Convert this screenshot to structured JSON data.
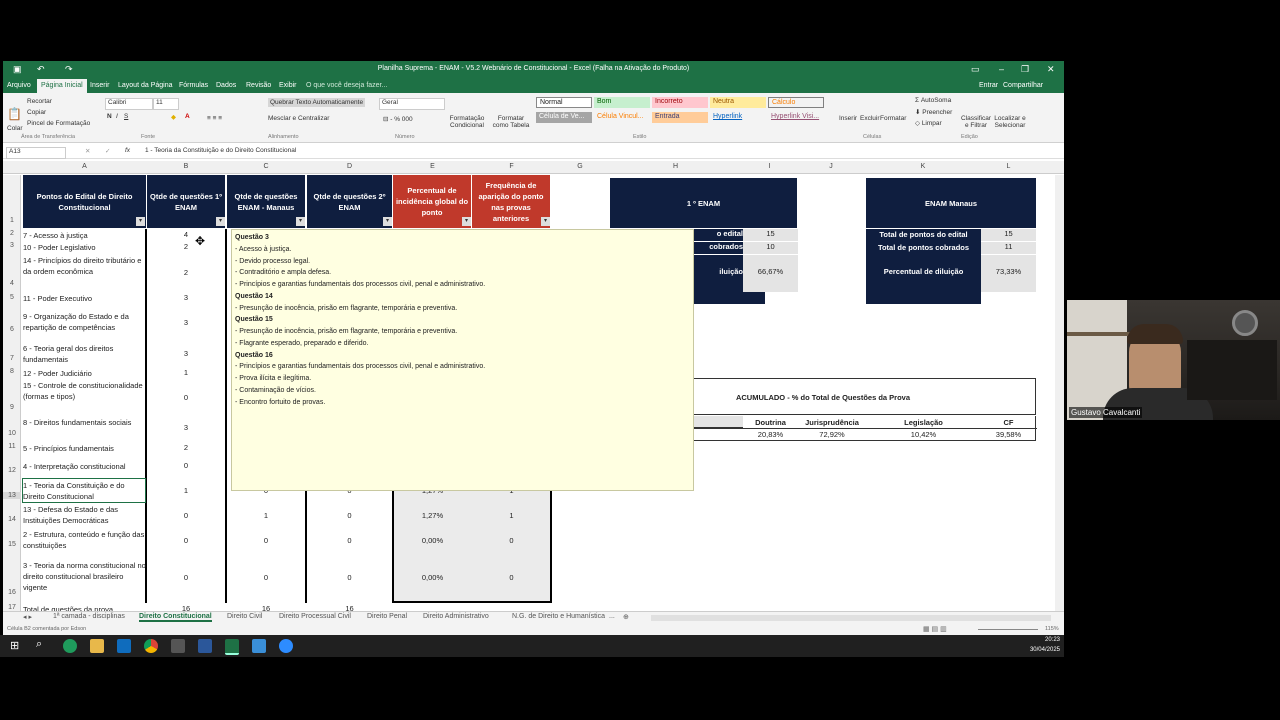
{
  "window": {
    "title": "Planilha Suprema - ENAM - V5.2 Webnário de Constitucional - Excel (Falha na Ativação do Produto)",
    "entrar": "Entrar",
    "compartilhar": "Compartilhar"
  },
  "menu": [
    "Arquivo",
    "Página Inicial",
    "Inserir",
    "Layout da Página",
    "Fórmulas",
    "Dados",
    "Revisão",
    "Exibir",
    "O que você deseja fazer..."
  ],
  "ribbon": {
    "recortar": "Recortar",
    "copiar": "Copiar",
    "pincel": "Pincel de Formatação",
    "colar": "Colar",
    "area_transferencia": "Área de Transferência",
    "fonte_nome": "Calibri",
    "fonte_tam": "11",
    "fonte": "Fonte",
    "quebrar": "Quebrar Texto Automaticamente",
    "mesclar": "Mesclar e Centralizar",
    "alinhamento": "Alinhamento",
    "geral": "Geral",
    "numero": "Número",
    "formatacao_cond": "Formatação Condicional",
    "formatar_tabela": "Formatar como Tabela",
    "estilo": "Estilo",
    "styles": {
      "normal": "Normal",
      "bom": "Bom",
      "incorreto": "Incorreto",
      "neutra": "Neutra",
      "calculo": "Cálculo",
      "celula_ve": "Célula de Ve...",
      "celula_vinc": "Célula Vincul...",
      "entrada": "Entrada",
      "hyperlink": "Hyperlink",
      "hyperlink_vis": "Hyperlink Visi..."
    },
    "inserir": "Inserir",
    "excluir": "Excluir",
    "formatar": "Formatar",
    "celulas": "Células",
    "autosoma": "AutoSoma",
    "preencher": "Preencher",
    "limpar": "Limpar",
    "classificar": "Classificar e Filtrar",
    "localizar": "Localizar e Selecionar",
    "edicao": "Edição"
  },
  "formula_bar": {
    "name_box": "A13",
    "fx": "fx",
    "value": "1 - Teoria da Constituição e do Direito Constitucional"
  },
  "columns": [
    "A",
    "B",
    "C",
    "D",
    "E",
    "F",
    "G",
    "H",
    "I",
    "J",
    "K",
    "L"
  ],
  "headers": {
    "a": "Pontos do Edital de Direito Constitucional",
    "b": "Qtde de questões 1º ENAM",
    "c": "Qtde de questões ENAM - Manaus",
    "d": "Qtde de questões 2º ENAM",
    "e": "Percentual de incidência global do ponto",
    "f": "Frequência de aparição do ponto nas provas anteriores"
  },
  "rows": [
    {
      "n": "2",
      "a": "7 - Acesso à justiça",
      "b": "4"
    },
    {
      "n": "3",
      "a": "10 - Poder Legislativo",
      "b": "2"
    },
    {
      "n": "4",
      "a": "14 - Princípios do direito tributário e da ordem econômica",
      "b": "2"
    },
    {
      "n": "5",
      "a": "11 - Poder Executivo",
      "b": "3"
    },
    {
      "n": "6",
      "a": "9 - Organização do Estado e da repartição de competências",
      "b": "3"
    },
    {
      "n": "7",
      "a": "6 - Teoria geral dos direitos fundamentais",
      "b": "3"
    },
    {
      "n": "8",
      "a": "12 - Poder Judiciário",
      "b": "1"
    },
    {
      "n": "9",
      "a": "15 - Controle de constitucionalidade (formas e tipos)",
      "b": "0"
    },
    {
      "n": "10",
      "a": "8 - Direitos fundamentais sociais",
      "b": "3"
    },
    {
      "n": "11",
      "a": "5 - Princípios fundamentais",
      "b": "2"
    },
    {
      "n": "12",
      "a": "4 - Interpretação constitucional",
      "b": "0"
    },
    {
      "n": "13",
      "a": "1 - Teoria da Constituição e do Direito Constitucional",
      "b": "1",
      "c": "0",
      "d": "0",
      "e": "1,27%",
      "f": "1"
    },
    {
      "n": "14",
      "a": "13 - Defesa do Estado e das Instituições Democráticas",
      "b": "0",
      "c": "1",
      "d": "0",
      "e": "1,27%",
      "f": "1"
    },
    {
      "n": "15",
      "a": "2 - Estrutura, conteúdo e função das constituições",
      "b": "0",
      "c": "0",
      "d": "0",
      "e": "0,00%",
      "f": "0"
    },
    {
      "n": "16",
      "a": "3 - Teoria da norma constitucional no direito constitucional brasileiro vigente",
      "b": "0",
      "c": "0",
      "d": "0",
      "e": "0,00%",
      "f": "0"
    },
    {
      "n": "17",
      "a": "Total de questões da prova",
      "b": "16",
      "c": "16",
      "d": "16"
    }
  ],
  "enam1": {
    "title": "1 º ENAM",
    "row1_label": "o edital",
    "row1_value": "15",
    "row2_label": "cobrados",
    "row2_value": "10",
    "row3_label": "iluição",
    "row3_value": "66,67%"
  },
  "manaus": {
    "title": "ENAM Manaus",
    "row1_label": "Total de pontos do edital",
    "row1_value": "15",
    "row2_label": "Total de pontos cobrados",
    "row2_value": "11",
    "row3_label": "Percentual de diluição",
    "row3_value": "73,33%"
  },
  "acumulado": {
    "title": "ACUMULADO - % do Total de Questões da Prova",
    "headers": [
      "Doutrina",
      "Jurisprudência",
      "Legislação",
      "CF"
    ],
    "values": [
      "20,83%",
      "72,92%",
      "10,42%",
      "39,58%"
    ]
  },
  "comment": [
    {
      "bold": true,
      "text": "Questão 3"
    },
    {
      "bold": false,
      "text": ""
    },
    {
      "bold": false,
      "text": "- Acesso à justiça."
    },
    {
      "bold": false,
      "text": "- Devido processo legal."
    },
    {
      "bold": false,
      "text": "- Contraditório e ampla defesa."
    },
    {
      "bold": false,
      "text": "- Princípios e garantias fundamentais dos processos civil, penal e administrativo."
    },
    {
      "bold": false,
      "text": ""
    },
    {
      "bold": true,
      "text": "Questão 14"
    },
    {
      "bold": false,
      "text": ""
    },
    {
      "bold": false,
      "text": "- Presunção de inocência, prisão em flagrante, temporária e preventiva."
    },
    {
      "bold": false,
      "text": ""
    },
    {
      "bold": true,
      "text": "Questão 15"
    },
    {
      "bold": false,
      "text": ""
    },
    {
      "bold": false,
      "text": "- Presunção de inocência, prisão em flagrante, temporária e preventiva."
    },
    {
      "bold": false,
      "text": "- Flagrante esperado, preparado e diferido."
    },
    {
      "bold": false,
      "text": ""
    },
    {
      "bold": true,
      "text": "Questão 16"
    },
    {
      "bold": false,
      "text": ""
    },
    {
      "bold": false,
      "text": "- Princípios e garantias fundamentais dos processos civil, penal e administrativo."
    },
    {
      "bold": false,
      "text": "- Prova ilícita e ilegítima."
    },
    {
      "bold": false,
      "text": "- Contaminação de vícios."
    },
    {
      "bold": false,
      "text": "- Encontro fortuito de provas."
    }
  ],
  "sheets": [
    "1ª camada - disciplinas",
    "Direito Constitucional",
    "Direito Civil",
    "Direito Processual Civil",
    "Direito Penal",
    "Direito Administrativo",
    "N.G. de Direito e Humanística",
    "..."
  ],
  "status": {
    "left": "Célula B2 comentada por Edson",
    "zoom": "115%"
  },
  "taskbar": {
    "time": "20:23",
    "date": "30/04/2025"
  },
  "webcam": {
    "name": "Gustavo Cavalcanti"
  },
  "colors": {
    "excel_green": "#1e7145",
    "navy": "#0f1e3f",
    "red": "#c0392b",
    "gray_cell": "#e4e4e4"
  }
}
